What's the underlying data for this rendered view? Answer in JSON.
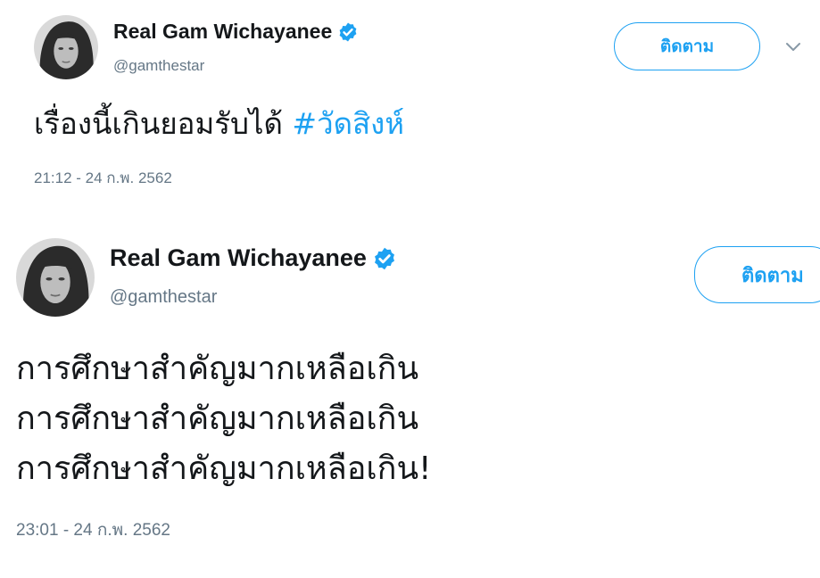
{
  "tweets": [
    {
      "display_name": "Real Gam Wichayanee",
      "handle": "@gamthestar",
      "follow_label": "ติดตาม",
      "text": "เรื่องนี้เกินยอมรับได้",
      "hashtag": "#วัดสิงห์",
      "timestamp": "21:12 - 24 ก.พ. 2562",
      "verified": true,
      "icons": {
        "verified": "verified-badge-icon",
        "menu": "chevron-down-icon"
      }
    },
    {
      "display_name": "Real Gam Wichayanee",
      "handle": "@gamthestar",
      "follow_label": "ติดตาม",
      "lines": [
        "การศึกษาสำคัญมากเหลือเกิน",
        "การศึกษาสำคัญมากเหลือเกิน",
        "การศึกษาสำคัญมากเหลือเกิน!"
      ],
      "timestamp": "23:01 - 24 ก.พ. 2562",
      "verified": true,
      "icons": {
        "verified": "verified-badge-icon"
      }
    }
  ],
  "colors": {
    "accent": "#1da1f2",
    "text": "#14171a",
    "secondary": "#657786"
  }
}
